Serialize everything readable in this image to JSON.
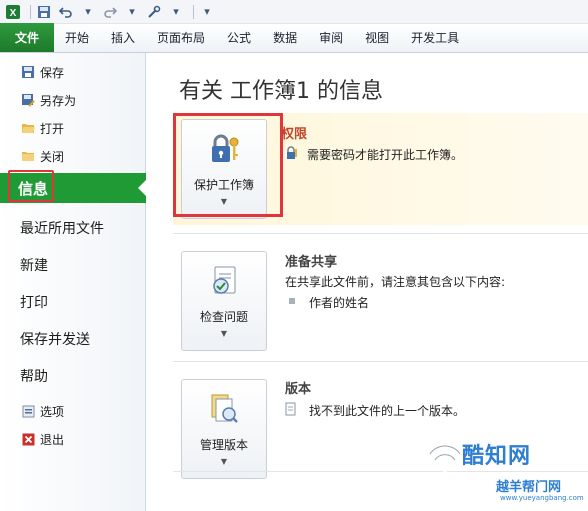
{
  "quick_access": {
    "icons": [
      "excel-icon",
      "save-icon",
      "undo-icon",
      "redo-icon",
      "customize-icon"
    ]
  },
  "ribbon": {
    "tabs": [
      "文件",
      "开始",
      "插入",
      "页面布局",
      "公式",
      "数据",
      "审阅",
      "视图",
      "开发工具"
    ]
  },
  "nav": {
    "save": "保存",
    "save_as": "另存为",
    "open": "打开",
    "close": "关闭",
    "info": "信息",
    "recent": "最近所用文件",
    "new": "新建",
    "print": "打印",
    "save_send": "保存并发送",
    "help": "帮助",
    "options": "选项",
    "exit": "退出"
  },
  "main": {
    "title": "有关 工作簿1 的信息",
    "permissions": {
      "button": "保护工作簿",
      "title": "权限",
      "desc": "需要密码才能打开此工作簿。"
    },
    "share": {
      "button": "检查问题",
      "title": "准备共享",
      "desc": "在共享此文件前，请注意其包含以下内容:",
      "bullet": "作者的姓名"
    },
    "versions": {
      "button": "管理版本",
      "title": "版本",
      "desc": "找不到此文件的上一个版本。"
    }
  },
  "watermark": {
    "name": "酷知网",
    "sub": "越羊帮门网",
    "url": "www.yueyangbang.com"
  },
  "colors": {
    "file_tab": "#1f9a34",
    "highlight": "#e0353b",
    "accent": "#2f7fd1"
  }
}
